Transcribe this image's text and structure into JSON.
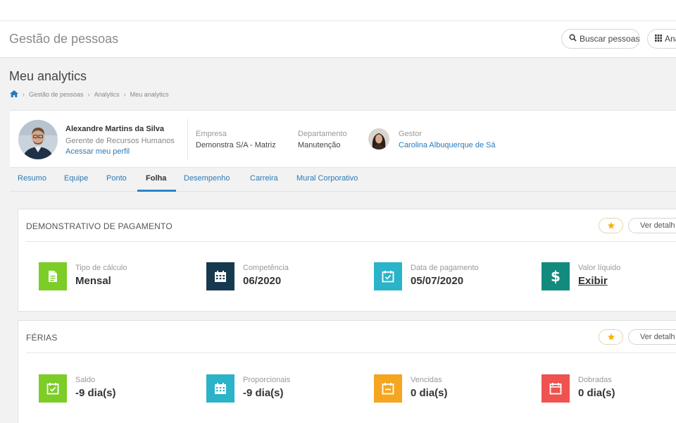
{
  "app": {
    "title": "Gestão de pessoas",
    "search_button": "Buscar pessoas",
    "analytics_button": "Ana"
  },
  "page": {
    "title": "Meu analytics",
    "breadcrumb": [
      "Gestão de pessoas",
      "Analytics",
      "Meu analytics"
    ]
  },
  "profile": {
    "name": "Alexandre Martins da Silva",
    "role": "Gerente de Recursos Humanos",
    "profile_link": "Acessar meu perfil",
    "company_label": "Empresa",
    "company_value": "Demonstra S/A - Matriz",
    "department_label": "Departamento",
    "department_value": "Manutenção",
    "manager_label": "Gestor",
    "manager_value": "Carolina Albuquerque de Sá"
  },
  "tabs": [
    {
      "label": "Resumo"
    },
    {
      "label": "Equipe"
    },
    {
      "label": "Ponto"
    },
    {
      "label": "Folha",
      "active": true
    },
    {
      "label": "Desempenho"
    },
    {
      "label": "Carreira"
    },
    {
      "label": "Mural Corporativo"
    }
  ],
  "payment": {
    "title": "DEMONSTRATIVO DE PAGAMENTO",
    "details_button": "Ver detalh",
    "stats": [
      {
        "label": "Tipo de cálculo",
        "value": "Mensal",
        "icon": "document-icon",
        "color": "#7ccd28"
      },
      {
        "label": "Competência",
        "value": "06/2020",
        "icon": "calendar-grid-icon",
        "color": "#16394f"
      },
      {
        "label": "Data de pagamento",
        "value": "05/07/2020",
        "icon": "calendar-check-icon",
        "color": "#2bb3c9"
      },
      {
        "label": "Valor líquido",
        "value": "Exibir",
        "icon": "dollar-icon",
        "color": "#138a7e"
      }
    ]
  },
  "vacation": {
    "title": "FÉRIAS",
    "details_button": "Ver detalh",
    "stats": [
      {
        "label": "Saldo",
        "value": "-9 dia(s)",
        "icon": "calendar-check-icon",
        "color": "#7ccd28"
      },
      {
        "label": "Proporcionais",
        "value": "-9 dia(s)",
        "icon": "calendar-grid-icon",
        "color": "#2bb3c9"
      },
      {
        "label": "Vencidas",
        "value": "0 dia(s)",
        "icon": "calendar-minus-icon",
        "color": "#f5a51f"
      },
      {
        "label": "Dobradas",
        "value": "0 dia(s)",
        "icon": "calendar-blank-icon",
        "color": "#ef5350"
      }
    ]
  },
  "colors": {
    "link": "#2a7ab8",
    "tab_underline": "#2a86c8",
    "star": "#f2b500"
  }
}
